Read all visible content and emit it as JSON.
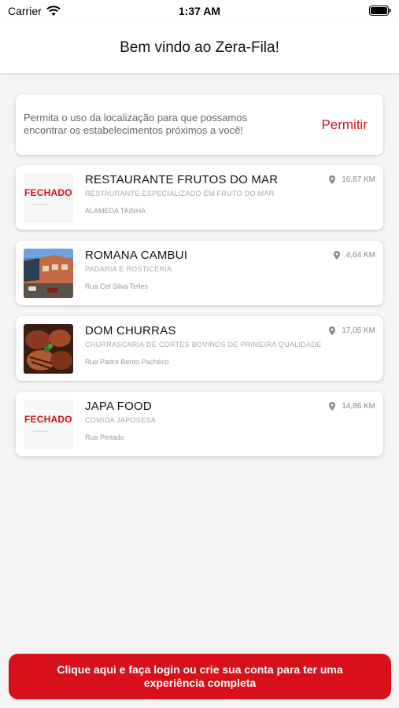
{
  "status_bar": {
    "carrier": "Carrier",
    "time": "1:37 AM"
  },
  "header": {
    "title": "Bem vindo ao Zera-Fila!"
  },
  "location_prompt": {
    "text": "Permita o uso da localização para que possamos encontrar os estabelecimentos próximos a você!",
    "button_label": "Permitir"
  },
  "restaurants": [
    {
      "name": "RESTAURANTE FRUTOS DO MAR",
      "category": "RESTAURANTE ESPECIALIZADO EM FRUTO DO MAR",
      "address": "ALAMEDA TAINHA",
      "distance": "16,87 KM",
      "thumb": "closed",
      "closed_label": "FECHADO"
    },
    {
      "name": "ROMANA CAMBUI",
      "category": "PADARIA E ROSTICERIA",
      "address": "Rua Cel Silva Telles",
      "distance": "4,64 KM",
      "thumb": "building-photo"
    },
    {
      "name": "DOM CHURRAS",
      "category": "CHURRASCARIA DE CORTES BOVINOS DE PRIMEIRA QUALIDADE",
      "address": "Rua Padre Bento Pachêco",
      "distance": "17,05 KM",
      "thumb": "steak-photo"
    },
    {
      "name": "JAPA FOOD",
      "category": "COMIDA JAPOSESA",
      "address": "Rua Pintado",
      "distance": "14,86 KM",
      "thumb": "closed",
      "closed_label": "FECHADO"
    }
  ],
  "login_button": {
    "label": "Clique aqui e faça login ou crie sua conta para ter uma experiência completa"
  },
  "colors": {
    "accent": "#d8101a",
    "background": "#f4f4f4"
  }
}
